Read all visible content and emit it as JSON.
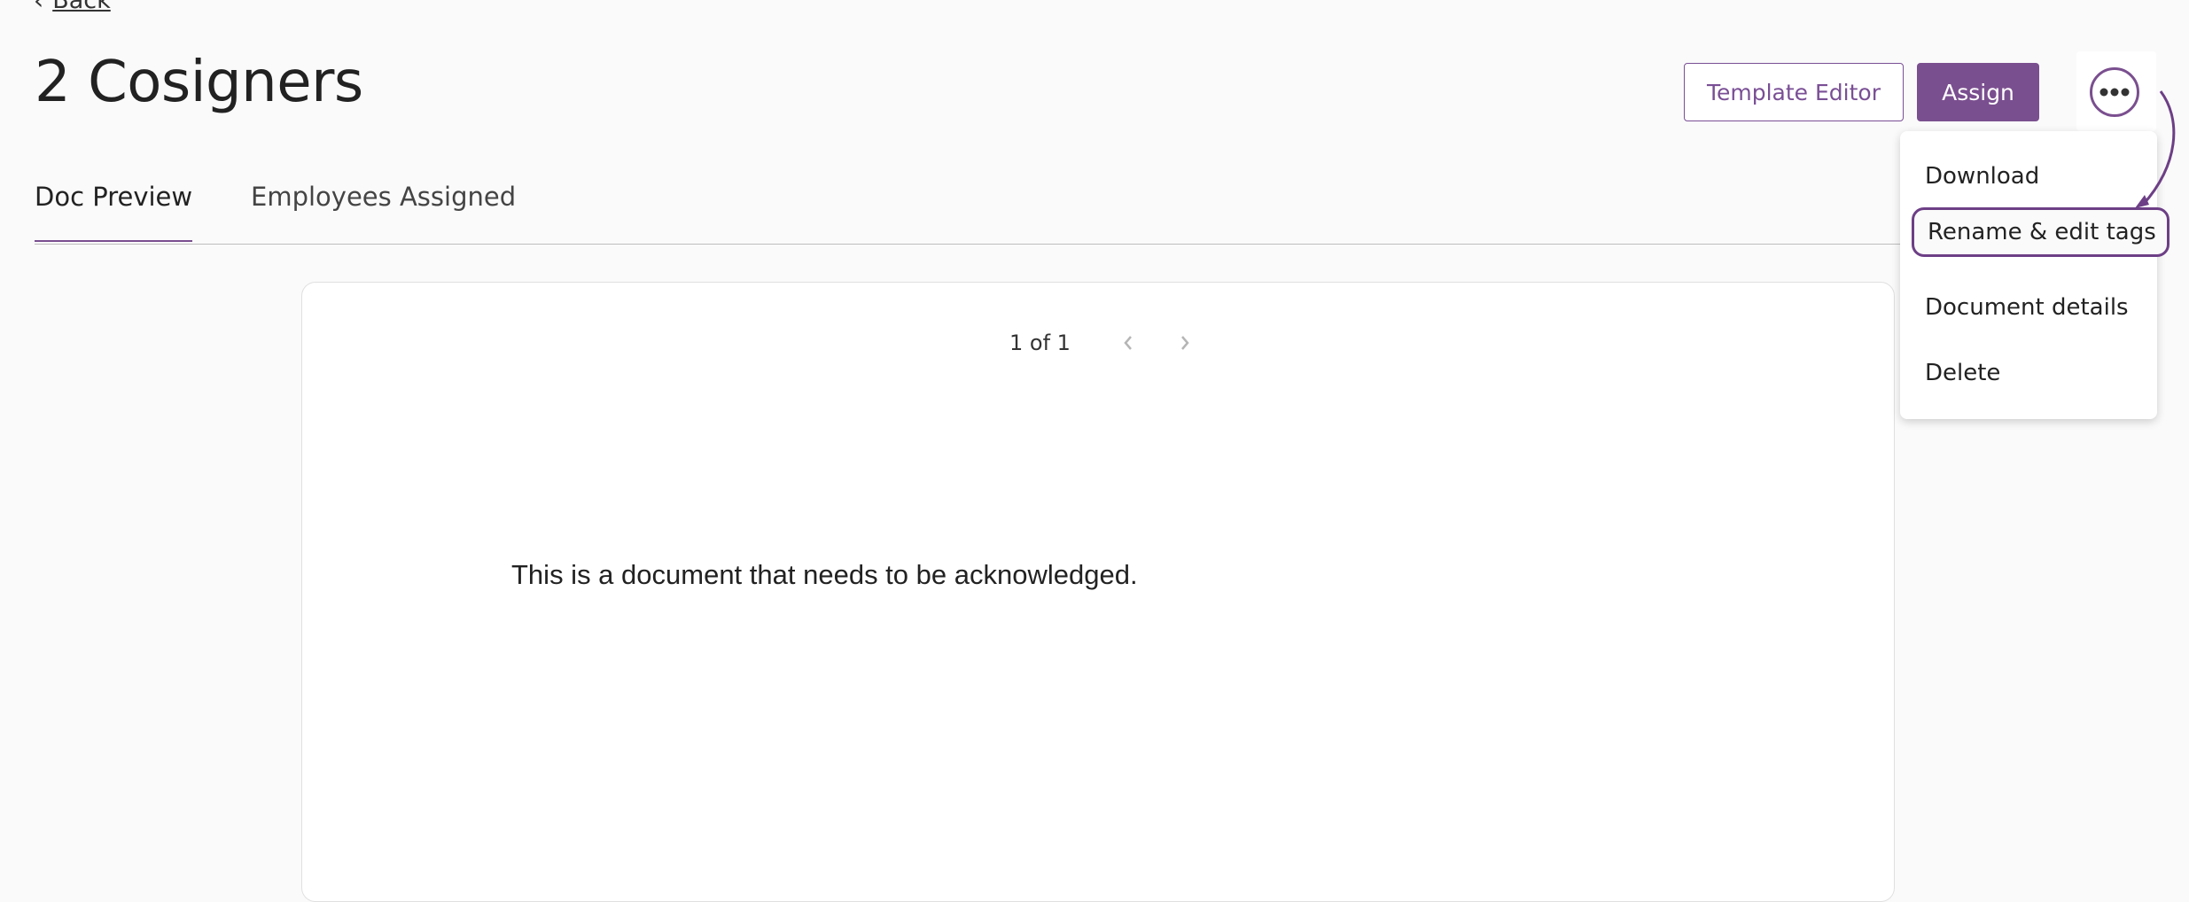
{
  "nav": {
    "back_label": "Back"
  },
  "header": {
    "title": "2 Cosigners",
    "template_editor_label": "Template Editor",
    "assign_label": "Assign",
    "more_icon": "more-horizontal-icon"
  },
  "tabs": [
    {
      "label": "Doc Preview",
      "active": true
    },
    {
      "label": "Employees Assigned",
      "active": false
    }
  ],
  "preview": {
    "page_indicator": "1 of 1",
    "body_text": "This is a document that needs to be acknowledged."
  },
  "menu": {
    "items": [
      {
        "label": "Download"
      },
      {
        "label": "Rename & edit tags",
        "highlighted": true
      },
      {
        "label": "Document details"
      },
      {
        "label": "Delete"
      }
    ]
  },
  "colors": {
    "accent": "#7a4f8f",
    "highlight_outline": "#6d3f86",
    "background": "#fafafa"
  }
}
